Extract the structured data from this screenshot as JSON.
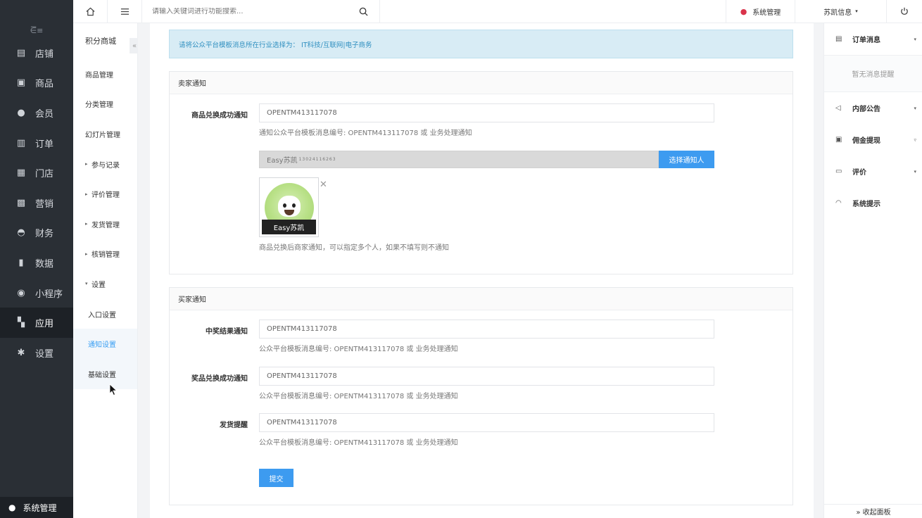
{
  "left_nav": {
    "collapse_icon": "menu-collapse-icon",
    "items": [
      {
        "label": "店铺",
        "icon": "store-icon",
        "glyph": "▤"
      },
      {
        "label": "商品",
        "icon": "goods-icon",
        "glyph": "▣"
      },
      {
        "label": "会员",
        "icon": "member-icon",
        "glyph": "●"
      },
      {
        "label": "订单",
        "icon": "order-icon",
        "glyph": "▥"
      },
      {
        "label": "门店",
        "icon": "shop-icon",
        "glyph": "▦"
      },
      {
        "label": "营销",
        "icon": "gift-icon",
        "glyph": "▩"
      },
      {
        "label": "财务",
        "icon": "money-bag-icon",
        "glyph": "◓"
      },
      {
        "label": "数据",
        "icon": "chart-icon",
        "glyph": "▮"
      },
      {
        "label": "小程序",
        "icon": "miniapp-icon",
        "glyph": "◉"
      },
      {
        "label": "应用",
        "icon": "apps-icon",
        "glyph": "▚"
      },
      {
        "label": "设置",
        "icon": "gear-icon",
        "glyph": "✱"
      }
    ],
    "active_index": 9,
    "bottom_label": "系统管理"
  },
  "sub_nav": {
    "title": "积分商城",
    "items": [
      {
        "label": "商品管理",
        "caret": "",
        "type": "item"
      },
      {
        "label": "分类管理",
        "caret": "",
        "type": "item"
      },
      {
        "label": "幻灯片管理",
        "caret": "",
        "type": "item"
      },
      {
        "label": "参与记录",
        "caret": "▸",
        "type": "item"
      },
      {
        "label": "评价管理",
        "caret": "▸",
        "type": "item"
      },
      {
        "label": "发货管理",
        "caret": "▸",
        "type": "item"
      },
      {
        "label": "核销管理",
        "caret": "▸",
        "type": "item"
      },
      {
        "label": "设置",
        "caret": "▾",
        "type": "item"
      },
      {
        "label": "入口设置",
        "caret": "",
        "type": "child"
      },
      {
        "label": "通知设置",
        "caret": "",
        "type": "child",
        "selected": true
      },
      {
        "label": "基础设置",
        "caret": "",
        "type": "child",
        "hover": true
      }
    ]
  },
  "topbar": {
    "search_placeholder": "请输入关键词进行功能搜索...",
    "sys_label": "系统管理",
    "user_label": "苏凯信息",
    "user_caret": "▾"
  },
  "notice": {
    "text": "请将公众平台模板消息所在行业选择为：  IT科技/互联网|电子商务"
  },
  "seller": {
    "heading": "卖家通知",
    "field_label": "商品兑换成功通知",
    "field_value": "OPENTM413117078",
    "field_help": "通知公众平台模板消息编号: OPENTM413117078 或 业务处理通知",
    "picker_name": "Easy苏凯",
    "picker_phone": "13024116263",
    "picker_button": "选择通知人",
    "avatar_name": "Easy苏凯",
    "close_glyph": "✕",
    "picker_help": "商品兑换后商家通知，可以指定多个人，如果不填写则不通知"
  },
  "buyer": {
    "heading": "买家通知",
    "rows": [
      {
        "label": "中奖结果通知",
        "value": "OPENTM413117078",
        "help": "公众平台模板消息编号: OPENTM413117078 或 业务处理通知"
      },
      {
        "label": "奖品兑换成功通知",
        "value": "OPENTM413117078",
        "help": "公众平台模板消息编号: OPENTM413117078 或 业务处理通知"
      },
      {
        "label": "发货提醒",
        "value": "OPENTM413117078",
        "help": "公众平台模板消息编号: OPENTM413117078 或 业务处理通知"
      }
    ],
    "submit_label": "提交"
  },
  "right_panel": {
    "items": [
      {
        "label": "订单消息",
        "icon": "clipboard-icon",
        "glyph": "▤",
        "arrow": "▾"
      },
      {
        "label": "内部公告",
        "icon": "speaker-icon",
        "glyph": "◁",
        "arrow": "▾"
      },
      {
        "label": "佣金提现",
        "icon": "wallet-icon",
        "glyph": "▣",
        "arrow": "▿"
      },
      {
        "label": "评价",
        "icon": "comment-icon",
        "glyph": "▭",
        "arrow": "▾"
      },
      {
        "label": "系统提示",
        "icon": "bell-icon",
        "glyph": "◠",
        "arrow": ""
      }
    ],
    "empty_text": "暂无消息提醒",
    "footer_label": "» 收起面板"
  },
  "colors": {
    "accent": "#3d9bf0",
    "sidebar_bg": "#2a2f35",
    "notice_bg": "#d8ecf5",
    "notice_text": "#2f8fc0",
    "user_icon": "#d9334b"
  }
}
